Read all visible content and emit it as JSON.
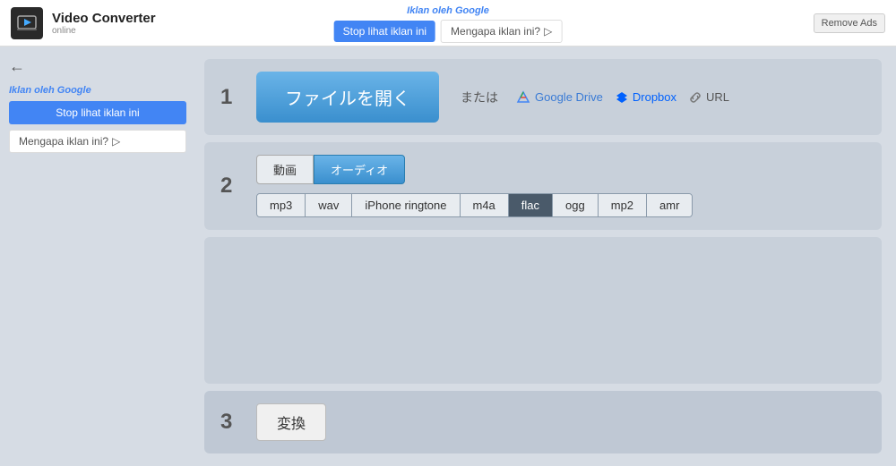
{
  "header": {
    "logo_title": "Video Converter",
    "logo_subtitle": "online",
    "remove_ads_label": "Remove Ads"
  },
  "top_ad": {
    "label_prefix": "Iklan oleh ",
    "label_brand": "Google",
    "stop_btn": "Stop lihat iklan ini",
    "why_btn": "Mengapa iklan ini?",
    "why_arrow": "▷"
  },
  "sidebar_ad": {
    "back_arrow": "←",
    "label_prefix": "Iklan oleh ",
    "label_brand": "Google",
    "stop_btn": "Stop lihat iklan ini",
    "why_btn": "Mengapa iklan ini?",
    "why_arrow": "▷"
  },
  "steps": {
    "step1": {
      "number": "1",
      "open_file_btn": "ファイルを開く",
      "or_text": "または",
      "google_drive_label": "Google Drive",
      "dropbox_label": "Dropbox",
      "url_label": "URL"
    },
    "step2": {
      "number": "2",
      "tab_video": "動画",
      "tab_audio": "オーディオ",
      "formats": [
        "mp3",
        "wav",
        "iPhone ringtone",
        "m4a",
        "flac",
        "ogg",
        "mp2",
        "amr"
      ],
      "selected_format": "flac"
    },
    "step3": {
      "number": "3",
      "convert_btn": "変換"
    }
  }
}
